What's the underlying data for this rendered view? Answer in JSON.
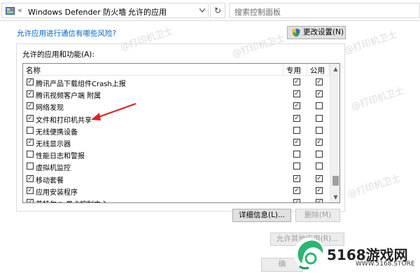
{
  "address_bar": {
    "nav_arrows": "«",
    "crumb1": "Windows Defender 防火墙",
    "separator": "›",
    "crumb2": "允许的应用",
    "dropdown_icon": "chevron-down-icon",
    "refresh_icon": "refresh-icon",
    "refresh_glyph": "↻",
    "search_placeholder": "搜索控制面板"
  },
  "top_link": "允许应用进行通信有哪些风险?",
  "change_settings_button": "更改设置(N)",
  "group_title": "允许的应用和功能(A):",
  "list": {
    "headers": {
      "name": "名称",
      "private": "专用",
      "public": "公用"
    },
    "rows": [
      {
        "label": "腾讯产品下载组件Crash上报",
        "enabled": true,
        "private": true,
        "public": true
      },
      {
        "label": "腾讯视频客户端 附属",
        "enabled": true,
        "private": true,
        "public": true
      },
      {
        "label": "网络发现",
        "enabled": true,
        "private": true,
        "public": false
      },
      {
        "label": "文件和打印机共享",
        "enabled": true,
        "private": true,
        "public": false
      },
      {
        "label": "无线便携设备",
        "enabled": false,
        "private": false,
        "public": false
      },
      {
        "label": "无线显示器",
        "enabled": true,
        "private": true,
        "public": true
      },
      {
        "label": "性能日志和警报",
        "enabled": false,
        "private": false,
        "public": false
      },
      {
        "label": "虚拟机监控",
        "enabled": false,
        "private": false,
        "public": false
      },
      {
        "label": "移动套餐",
        "enabled": true,
        "private": true,
        "public": true
      },
      {
        "label": "应用安装程序",
        "enabled": true,
        "private": true,
        "public": true
      },
      {
        "label": "英特尔® 显卡控制中心",
        "enabled": true,
        "private": true,
        "public": true
      }
    ],
    "scroll_up_glyph": "▲",
    "scroll_down_glyph": "▼"
  },
  "details_button": "详细信息(L)...",
  "delete_button": "删除(M)",
  "allow_other_button": "允许其他应用(R)...",
  "ok_button": "确",
  "check_glyph": "✓",
  "watermark": "@打印机卫士",
  "logo": {
    "text": "5168游戏网",
    "url": "WWW.5168.STORE"
  },
  "colors": {
    "link": "#0066cc",
    "annotation_arrow": "#e02020",
    "logo_green": "#2bb673"
  }
}
